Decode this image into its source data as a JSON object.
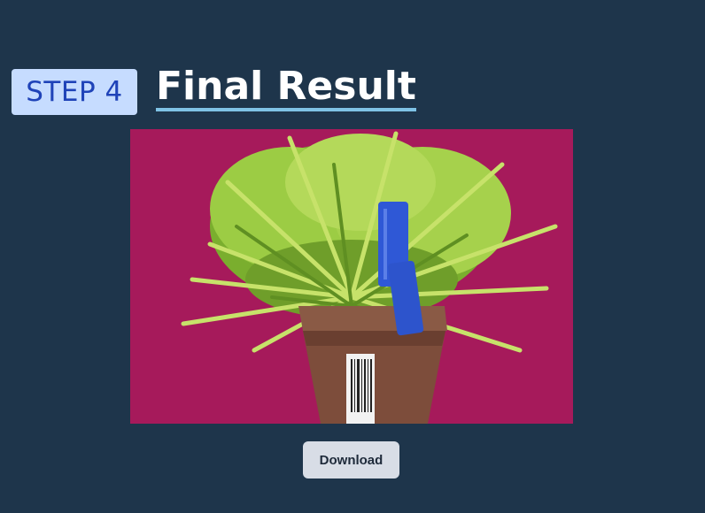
{
  "header": {
    "step_label": "STEP 4",
    "title": "Final Result"
  },
  "result": {
    "image_subject": "potted-plant-on-magenta",
    "background_color": "#a61a5b"
  },
  "actions": {
    "download_label": "Download"
  },
  "colors": {
    "page_background": "#1e354b",
    "badge_background": "#c6dcff",
    "badge_text": "#1f43b8",
    "title_underline": "#7fc3e6",
    "button_background": "#d8dde6"
  }
}
